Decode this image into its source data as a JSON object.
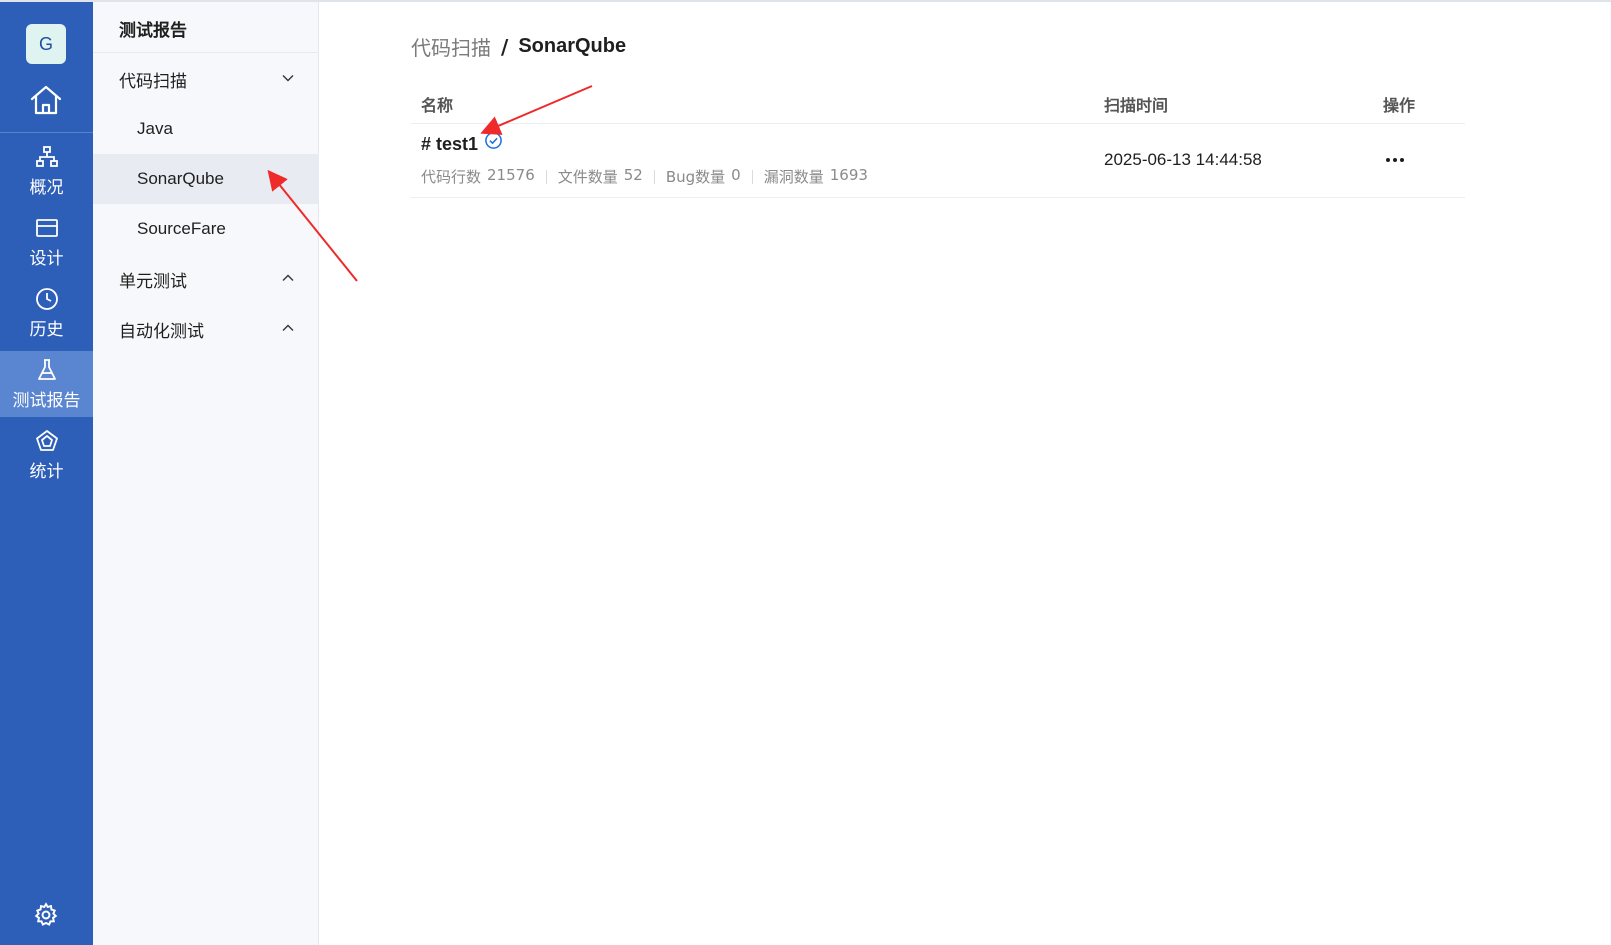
{
  "rail": {
    "avatar_letter": "G",
    "items": [
      {
        "label": "概况",
        "icon": "hierarchy-icon"
      },
      {
        "label": "设计",
        "icon": "card-icon"
      },
      {
        "label": "历史",
        "icon": "clock-icon"
      },
      {
        "label": "测试报告",
        "icon": "flask-icon",
        "active": true
      },
      {
        "label": "统计",
        "icon": "pentagon-icon"
      }
    ]
  },
  "sidebar": {
    "title": "测试报告",
    "groups": [
      {
        "label": "代码扫描",
        "expanded": true,
        "items": [
          "Java",
          "SonarQube",
          "SourceFare"
        ],
        "active_item": "SonarQube"
      },
      {
        "label": "单元测试",
        "expanded": false
      },
      {
        "label": "自动化测试",
        "expanded": false
      }
    ]
  },
  "breadcrumb": {
    "parent": "代码扫描",
    "separator": "/",
    "current": "SonarQube"
  },
  "table": {
    "columns": [
      "名称",
      "扫描时间",
      "操作"
    ],
    "rows": [
      {
        "name": "# test1",
        "status_icon": "check-circle-icon",
        "meta": [
          {
            "label": "代码行数",
            "value": "21576"
          },
          {
            "label": "文件数量",
            "value": "52"
          },
          {
            "label": "Bug数量",
            "value": "0"
          },
          {
            "label": "漏洞数量",
            "value": "1693"
          }
        ],
        "scan_time": "2025-06-13 14:44:58",
        "action_icon": "more-icon"
      }
    ]
  },
  "colors": {
    "rail": "#2e5fb8",
    "rail_active": "#5a85d1",
    "accent": "#1e6fe0",
    "annotation_arrow": "#ee2a2a"
  }
}
